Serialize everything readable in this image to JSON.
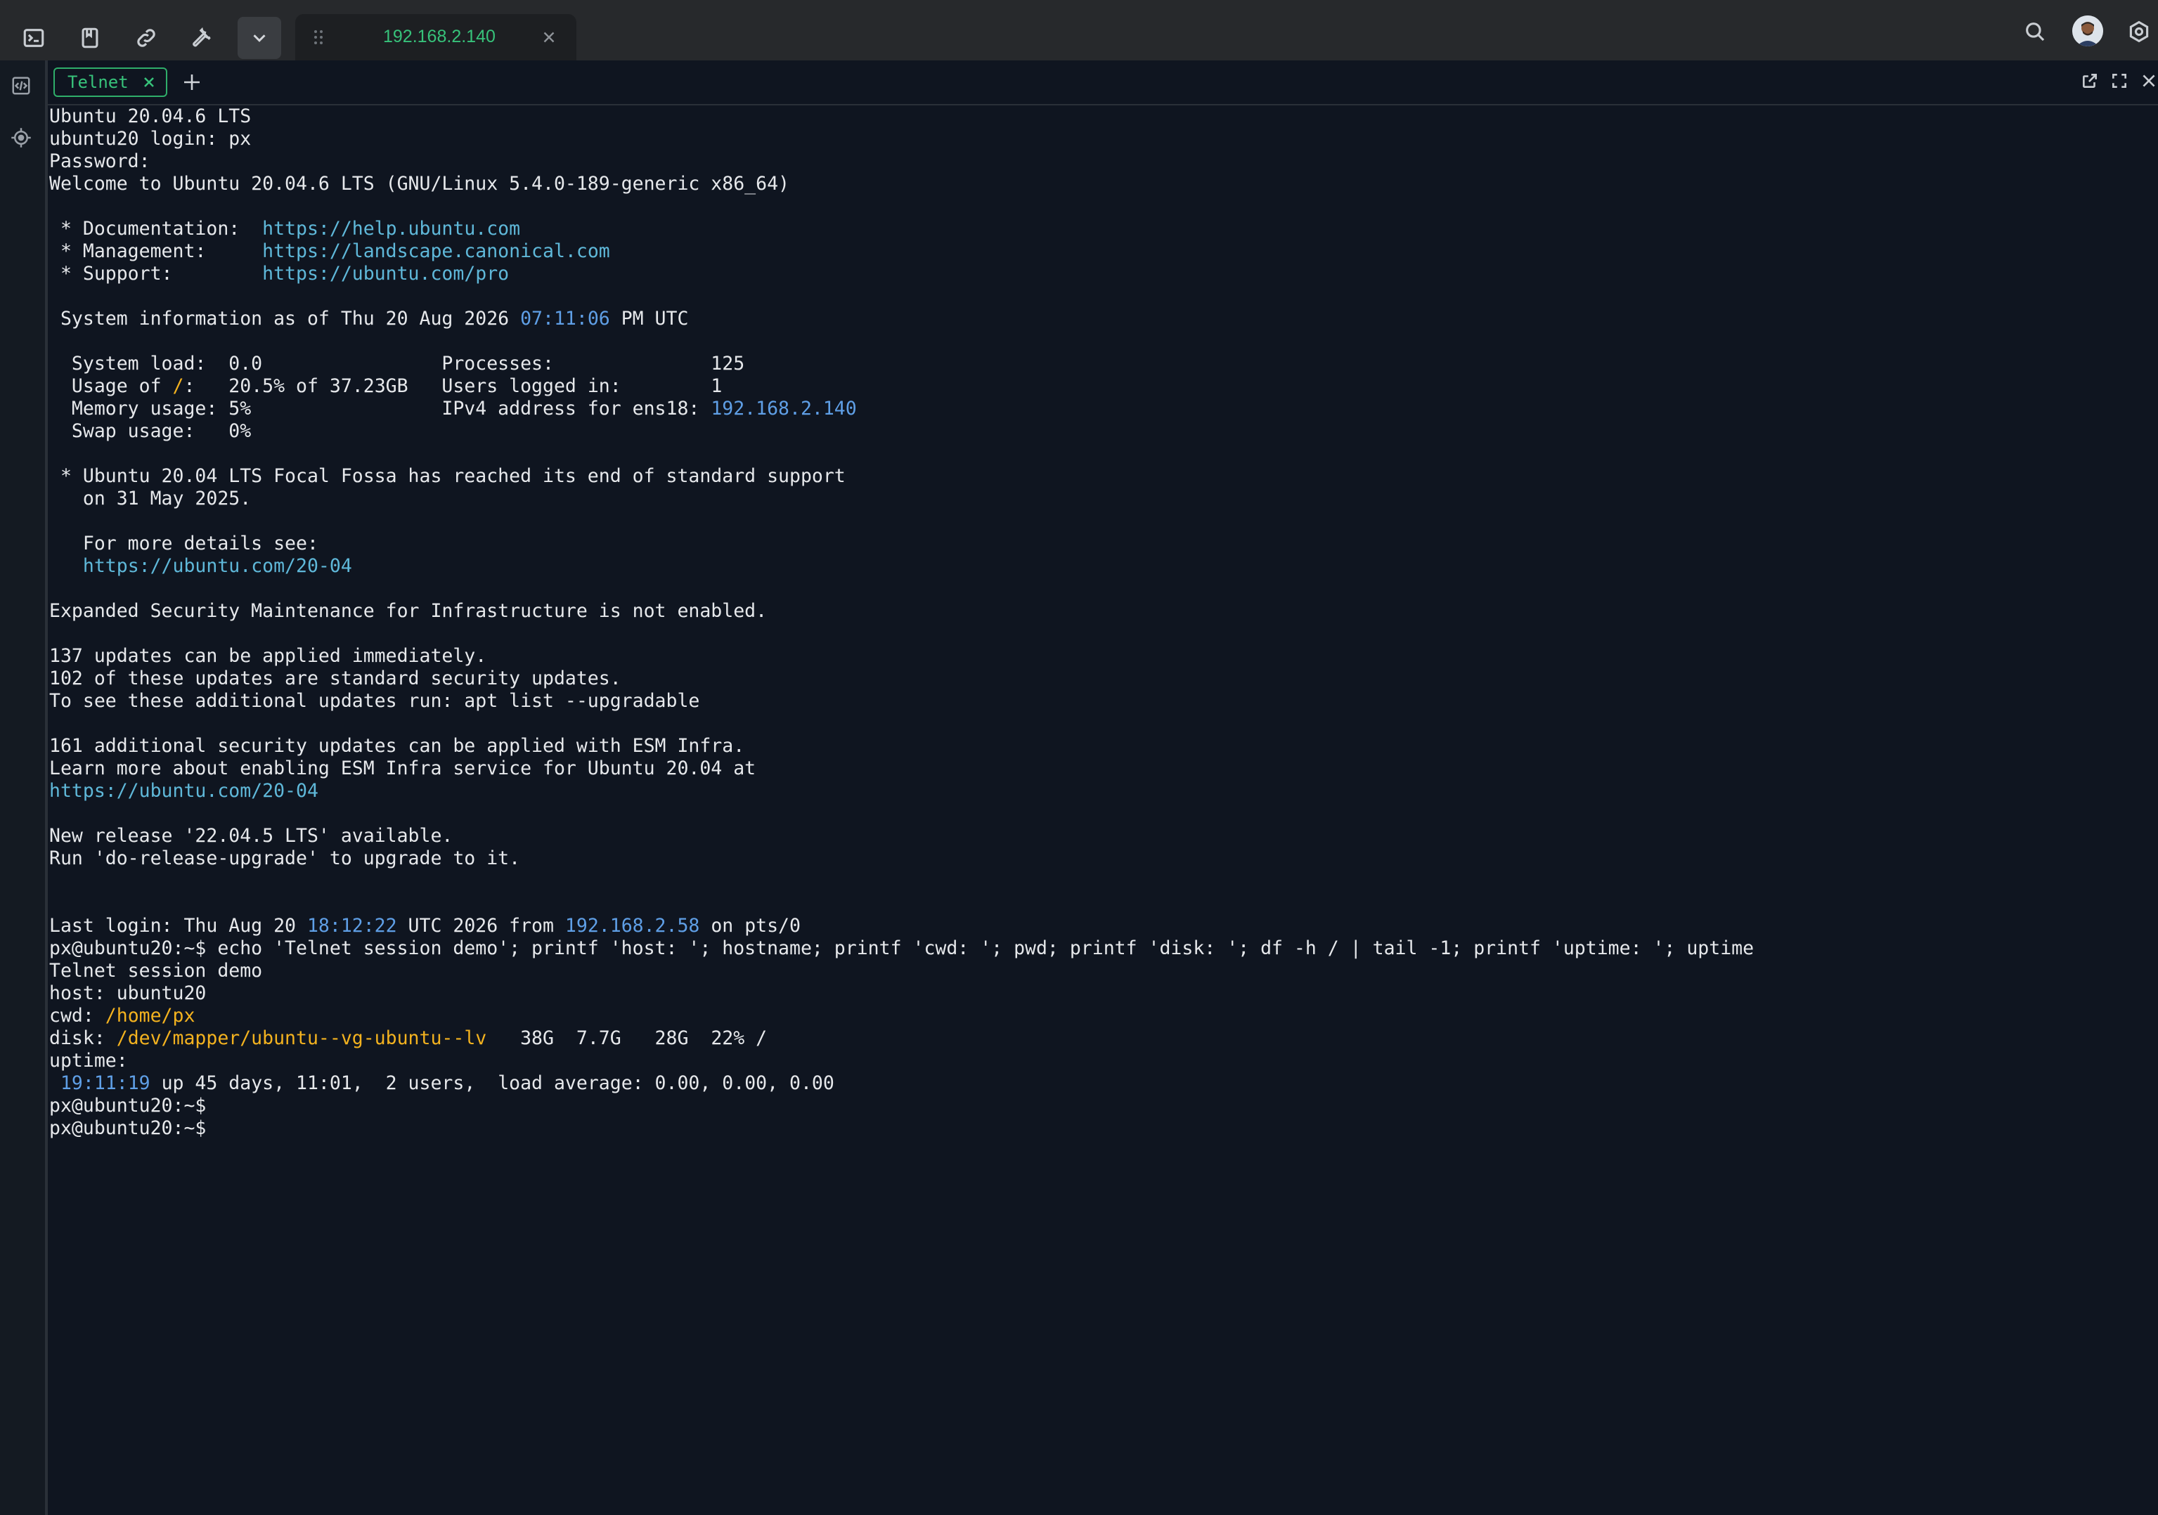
{
  "topbar": {
    "icons": [
      "terminal-icon",
      "bookmark-icon",
      "link-icon",
      "wrench-icon",
      "chevron-down-icon"
    ],
    "session_tab": {
      "title": "192.168.2.140"
    },
    "right_icons": [
      "search-icon",
      "avatar",
      "settings-icon"
    ]
  },
  "leftrail": {
    "icons": [
      "code-icon",
      "crosshair-icon"
    ]
  },
  "tabs": {
    "active": "Telnet",
    "add_label": "+"
  },
  "colors": {
    "accent_green": "#37c27a",
    "link": "#5fb8d9",
    "number": "#5f9fe6",
    "path": "#f3b21f",
    "terminal_bg": "#0f1520",
    "text": "#e6e8eb"
  },
  "terminal": {
    "lines": [
      [
        {
          "t": "Ubuntu 20.04.6 LTS"
        }
      ],
      [
        {
          "t": "ubuntu20 login: px"
        }
      ],
      [
        {
          "t": "Password:"
        }
      ],
      [
        {
          "t": "Welcome to Ubuntu 20.04.6 LTS (GNU/Linux 5.4.0-189-generic x86_64)"
        }
      ],
      [],
      [
        {
          "t": " * Documentation:  "
        },
        {
          "t": "https://help.ubuntu.com",
          "c": "link"
        }
      ],
      [
        {
          "t": " * Management:     "
        },
        {
          "t": "https://landscape.canonical.com",
          "c": "link"
        }
      ],
      [
        {
          "t": " * Support:        "
        },
        {
          "t": "https://ubuntu.com/pro",
          "c": "link"
        }
      ],
      [],
      [
        {
          "t": " System information as of Thu 20 Aug 2026 "
        },
        {
          "t": "07:11:06",
          "c": "num"
        },
        {
          "t": " PM UTC"
        }
      ],
      [],
      [
        {
          "t": "  System load:  0.0                Processes:              125"
        }
      ],
      [
        {
          "t": "  Usage of "
        },
        {
          "t": "/",
          "c": "path"
        },
        {
          "t": ":   20.5% of 37.23GB   Users logged in:        1"
        }
      ],
      [
        {
          "t": "  Memory usage: 5%                 IPv4 address for ens18: "
        },
        {
          "t": "192.168.2.140",
          "c": "num"
        }
      ],
      [
        {
          "t": "  Swap usage:   0%"
        }
      ],
      [],
      [
        {
          "t": " * Ubuntu 20.04 LTS Focal Fossa has reached its end of standard support"
        }
      ],
      [
        {
          "t": "   on 31 May 2025."
        }
      ],
      [],
      [
        {
          "t": "   For more details see:"
        }
      ],
      [
        {
          "t": "   "
        },
        {
          "t": "https://ubuntu.com/20-04",
          "c": "link"
        }
      ],
      [],
      [
        {
          "t": "Expanded Security Maintenance for Infrastructure is not enabled."
        }
      ],
      [],
      [
        {
          "t": "137 updates can be applied immediately."
        }
      ],
      [
        {
          "t": "102 of these updates are standard security updates."
        }
      ],
      [
        {
          "t": "To see these additional updates run: apt list --upgradable"
        }
      ],
      [],
      [
        {
          "t": "161 additional security updates can be applied with ESM Infra."
        }
      ],
      [
        {
          "t": "Learn more about enabling ESM Infra service for Ubuntu 20.04 at"
        }
      ],
      [
        {
          "t": "https://ubuntu.com/20-04",
          "c": "link"
        }
      ],
      [],
      [
        {
          "t": "New release '22.04.5 LTS' available."
        }
      ],
      [
        {
          "t": "Run 'do-release-upgrade' to upgrade to it."
        }
      ],
      [],
      [],
      [
        {
          "t": "Last login: Thu Aug 20 "
        },
        {
          "t": "18:12:22",
          "c": "num"
        },
        {
          "t": " UTC 2026 from "
        },
        {
          "t": "192.168.2.58",
          "c": "num"
        },
        {
          "t": " on pts/0"
        }
      ],
      [
        {
          "t": "px@ubuntu20:~$ echo 'Telnet session demo'; printf 'host: '; hostname; printf 'cwd: '; pwd; printf 'disk: '; df -h / | tail -1; printf 'uptime: '; uptime"
        }
      ],
      [
        {
          "t": "Telnet session demo"
        }
      ],
      [
        {
          "t": "host: ubuntu20"
        }
      ],
      [
        {
          "t": "cwd: "
        },
        {
          "t": "/home/px",
          "c": "path"
        }
      ],
      [
        {
          "t": "disk: "
        },
        {
          "t": "/dev/mapper/ubuntu--vg-ubuntu--lv",
          "c": "path"
        },
        {
          "t": "   38G  7.7G   28G  22% /"
        }
      ],
      [
        {
          "t": "uptime:"
        }
      ],
      [
        {
          "t": " "
        },
        {
          "t": "19:11:19",
          "c": "num"
        },
        {
          "t": " up 45 days, 11:01,  2 users,  load average: 0.00, 0.00, 0.00"
        }
      ],
      [
        {
          "t": "px@ubuntu20:~$"
        }
      ],
      [
        {
          "t": "px@ubuntu20:~$"
        }
      ]
    ]
  }
}
